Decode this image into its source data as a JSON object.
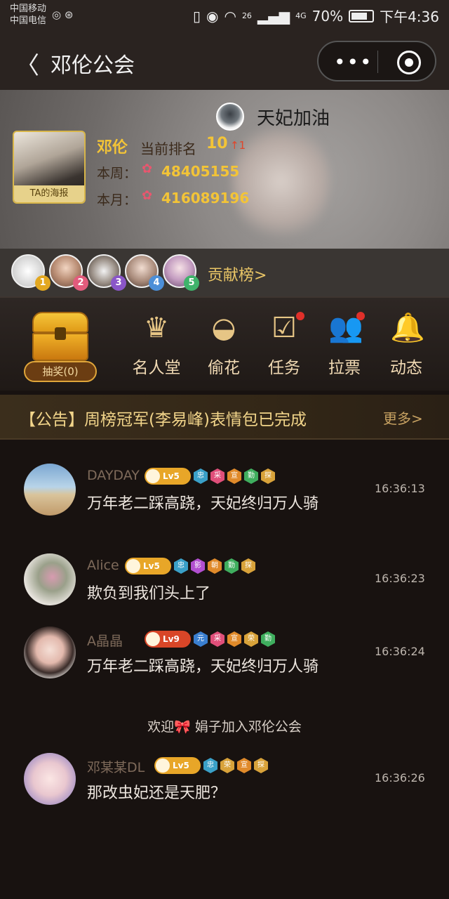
{
  "status_bar": {
    "carrier1": "中国移动",
    "carrier2": "中国电信",
    "network1": "26",
    "network2": "4G",
    "battery": "70%",
    "time": "下午4:36"
  },
  "nav": {
    "back_icon": "chevron-left-icon",
    "title": "邓伦公会",
    "more_icon": "more-dots-icon",
    "close_icon": "target-close-icon"
  },
  "hero": {
    "poster_label": "TA的海报",
    "name": "邓伦",
    "rank_label": "当前排名",
    "rank_value": "10",
    "rank_change": "↑1",
    "week_label": "本周：",
    "week_value": "48405155",
    "month_label": "本月：",
    "month_value": "416089196",
    "cheer_text": "天妃加油"
  },
  "contributors": {
    "ranks": [
      "1",
      "2",
      "3",
      "4",
      "5"
    ],
    "link": "贡献榜>"
  },
  "features": {
    "lottery": "抽奖(0)",
    "items": [
      {
        "label": "名人堂",
        "icon": "crown-icon"
      },
      {
        "label": "偷花",
        "icon": "masked-face-icon"
      },
      {
        "label": "任务",
        "icon": "clipboard-check-icon"
      },
      {
        "label": "拉票",
        "icon": "users-icon"
      },
      {
        "label": "动态",
        "icon": "bell-icon"
      }
    ]
  },
  "notice": {
    "text": "【公告】周榜冠军(李易峰)表情包已完成",
    "more": "更多>"
  },
  "messages": [
    {
      "user": "DAYDAY",
      "level": "Lv5",
      "medals": [
        "忠",
        "采",
        "宣",
        "勤",
        "探"
      ],
      "text": "万年老二踩高跷，天妃终归万人骑",
      "time": "16:36:13"
    },
    {
      "user": "Alice",
      "level": "Lv5",
      "medals": [
        "忠",
        "影",
        "朝",
        "勤",
        "探"
      ],
      "text": "欺负到我们头上了",
      "time": "16:36:23"
    },
    {
      "user": "A晶晶",
      "level": "Lv9",
      "medals": [
        "元",
        "采",
        "宣",
        "荣",
        "勤"
      ],
      "text": "万年老二踩高跷，天妃终归万人骑",
      "time": "16:36:24"
    },
    {
      "user": "邓某某DL",
      "level": "Lv5",
      "medals": [
        "忠",
        "荣",
        "宣",
        "探"
      ],
      "text": "那改虫妃还是天肥？",
      "time": "16:36:26"
    }
  ],
  "welcome": "欢迎🎀 娟子加入邓伦公会",
  "colors": {
    "accent_gold": "#f3c437",
    "background": "#181210"
  }
}
